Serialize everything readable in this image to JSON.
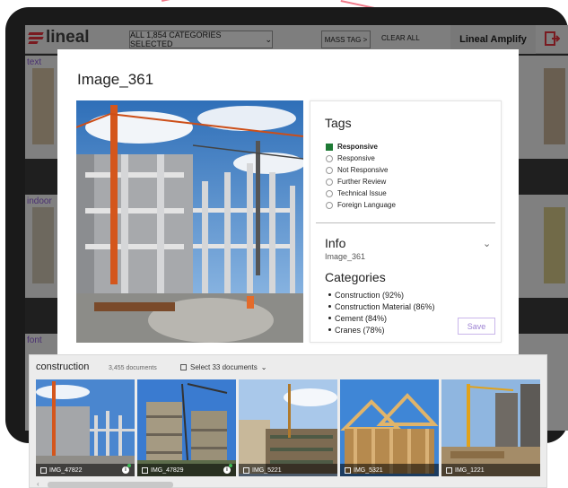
{
  "app": {
    "logo_text": "lineal",
    "category_select_label": "ALL 1,854 CATEGORIES SELECTED",
    "mass_tag_label": "MASS TAG >",
    "clear_all_label": "CLEAR ALL",
    "amplify_label": "Lineal Amplify",
    "exit_icon": "exit-icon",
    "brand_color": "#e8333f",
    "accent_color": "#8c5ad8"
  },
  "background_categories": [
    {
      "label": "text"
    },
    {
      "label": "indoor"
    },
    {
      "label": "font"
    }
  ],
  "modal": {
    "title": "Image_361",
    "tags": {
      "title": "Tags",
      "options": [
        {
          "label": "Responsive",
          "selected": true
        },
        {
          "label": "Responsive",
          "selected": false
        },
        {
          "label": "Not Responsive",
          "selected": false
        },
        {
          "label": "Further Review",
          "selected": false
        },
        {
          "label": "Technical Issue",
          "selected": false
        },
        {
          "label": "Foreign Language",
          "selected": false
        }
      ]
    },
    "info": {
      "title": "Info",
      "value": "Image_361"
    },
    "categories": {
      "title": "Categories",
      "items": [
        "Construction (92%)",
        "Construction Material (86%)",
        "Cement (84%)",
        "Cranes (78%)"
      ]
    },
    "save_label": "Save"
  },
  "drawer": {
    "title": "construction",
    "count": "3,455 documents",
    "select_label": "Select 33 documents",
    "thumbnails": [
      {
        "label": "IMG_47822",
        "info": true
      },
      {
        "label": "IMG_47829",
        "info": true
      },
      {
        "label": "IMG_5221",
        "info": false
      },
      {
        "label": "IMG_5321",
        "info": false
      },
      {
        "label": "IMG_1221",
        "info": false
      }
    ]
  }
}
